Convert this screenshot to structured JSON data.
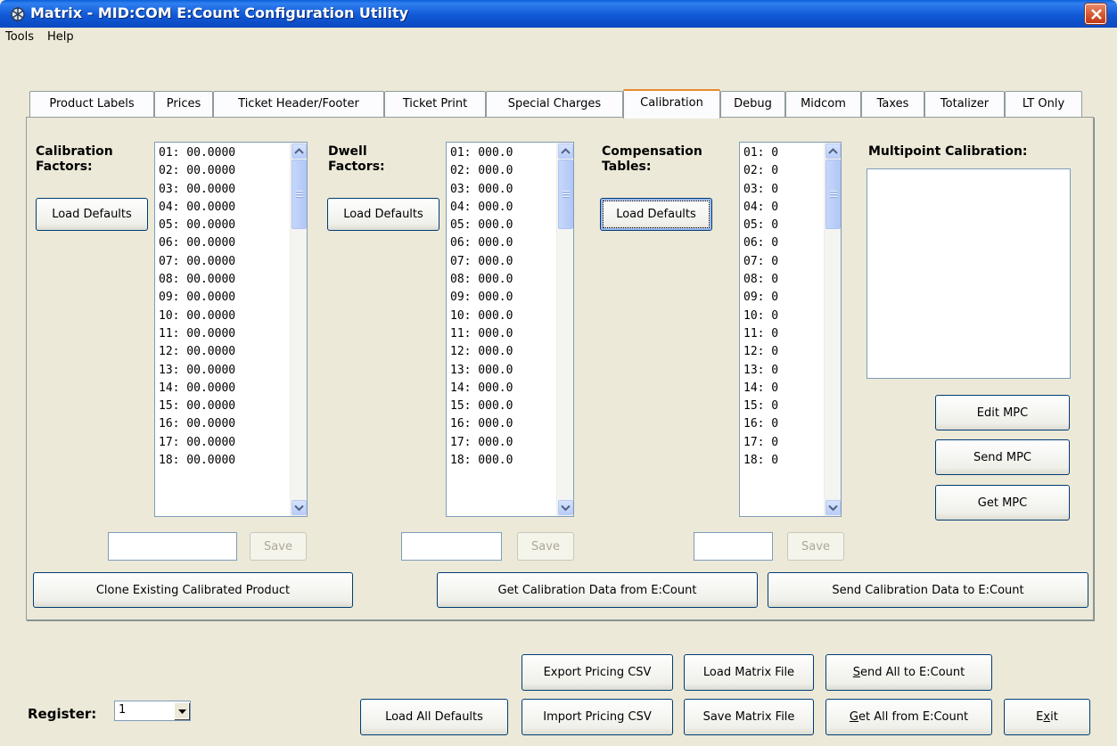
{
  "window": {
    "title": "Matrix - MID:COM E:Count Configuration Utility"
  },
  "menu": [
    "Tools",
    "Help"
  ],
  "tabs": [
    "Product Labels",
    "Prices",
    "Ticket Header/Footer",
    "Ticket Print",
    "Special Charges",
    "Calibration",
    "Debug",
    "Midcom",
    "Taxes",
    "Totalizer",
    "LT Only"
  ],
  "active_tab": "Calibration",
  "calibration": {
    "cal_factors": {
      "label_line1": "Calibration",
      "label_line2": "Factors:",
      "load_defaults": "Load Defaults",
      "items": [
        "01: 00.0000",
        "02: 00.0000",
        "03: 00.0000",
        "04: 00.0000",
        "05: 00.0000",
        "06: 00.0000",
        "07: 00.0000",
        "08: 00.0000",
        "09: 00.0000",
        "10: 00.0000",
        "11: 00.0000",
        "12: 00.0000",
        "13: 00.0000",
        "14: 00.0000",
        "15: 00.0000",
        "16: 00.0000",
        "17: 00.0000",
        "18: 00.0000"
      ],
      "input_value": "",
      "save": "Save"
    },
    "dwell_factors": {
      "label_line1": "Dwell",
      "label_line2": "Factors:",
      "load_defaults": "Load Defaults",
      "items": [
        "01: 000.0",
        "02: 000.0",
        "03: 000.0",
        "04: 000.0",
        "05: 000.0",
        "06: 000.0",
        "07: 000.0",
        "08: 000.0",
        "09: 000.0",
        "10: 000.0",
        "11: 000.0",
        "12: 000.0",
        "13: 000.0",
        "14: 000.0",
        "15: 000.0",
        "16: 000.0",
        "17: 000.0",
        "18: 000.0"
      ],
      "input_value": "",
      "save": "Save"
    },
    "comp_tables": {
      "label_line1": "Compensation",
      "label_line2": "Tables:",
      "load_defaults": "Load Defaults",
      "items": [
        "01: 0",
        "02: 0",
        "03: 0",
        "04: 0",
        "05: 0",
        "06: 0",
        "07: 0",
        "08: 0",
        "09: 0",
        "10: 0",
        "11: 0",
        "12: 0",
        "13: 0",
        "14: 0",
        "15: 0",
        "16: 0",
        "17: 0",
        "18: 0"
      ],
      "input_value": "",
      "save": "Save"
    },
    "multipoint": {
      "label": "Multipoint Calibration:",
      "edit": "Edit MPC",
      "send": "Send MPC",
      "get": "Get MPC"
    },
    "clone_button": "Clone Existing Calibrated Product",
    "get_cal_button": "Get Calibration Data from E:Count",
    "send_cal_button": "Send Calibration Data to E:Count"
  },
  "footer": {
    "register_label": "Register:",
    "register_value": "1",
    "load_all_defaults": "Load All Defaults",
    "export_csv": "Export Pricing CSV",
    "import_csv": "Import Pricing CSV",
    "load_matrix": "Load Matrix File",
    "save_matrix": "Save Matrix File",
    "send_all_first": "S",
    "send_all_rest": "end All to E:Count",
    "get_all_first": "G",
    "get_all_rest": "et All from E:Count",
    "exit_pre": "E",
    "exit_ul": "x",
    "exit_post": "it"
  }
}
